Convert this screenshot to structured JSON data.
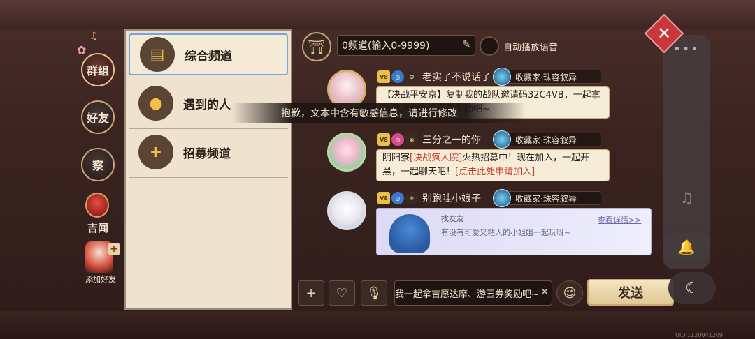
{
  "left_nav": {
    "group_label": "群组",
    "friends_label": "好友",
    "observe_label": "察",
    "news_label": "吉闻",
    "add_friend_label": "添加好友"
  },
  "channels": [
    {
      "label": "综合频道",
      "icon": "chat-bubbles-icon"
    },
    {
      "label": "遇到的人",
      "icon": "gourd-icon"
    },
    {
      "label": "招募频道",
      "icon": "recruit-plus-icon"
    }
  ],
  "header": {
    "channel_input": "0频道(输入0-9999)",
    "auto_voice_label": "自动播放语音"
  },
  "messages": [
    {
      "username": "老实了不说话了",
      "title": "收藏家·珠容叙异",
      "text": "【决战平安京】复制我的战队邀请码32C4VB，一起拿吉愿达摩、游园券奖励吧~"
    },
    {
      "username": "三分之一的你",
      "title": "收藏家·珠容叙异",
      "text_prefix": "阴阳寮",
      "text_highlight": "[决战疯人院]",
      "text_mid": "火热招募中！现在加入，一起开黑，一起聊天吧！",
      "text_link": "[点击此处申请加入]"
    },
    {
      "username": "别跑哇小娘子",
      "title": "收藏家·珠容叙异",
      "card_title": "找友友",
      "card_link": "查看详情>>",
      "card_desc": "有没有可爱又粘人的小姐姐一起玩呀~"
    }
  ],
  "toast": "抱歉，文本中含有敏感信息，请进行修改",
  "input": {
    "value": "我一起拿吉愿达摩、游园券奖励吧~",
    "send_label": "发送"
  },
  "uid": "UID:1120041209",
  "colors": {
    "accent_red": "#c8383a",
    "highlight_red": "#c83a2a",
    "panel_bg": "#efe3cf",
    "active_border": "#74a6e0"
  }
}
